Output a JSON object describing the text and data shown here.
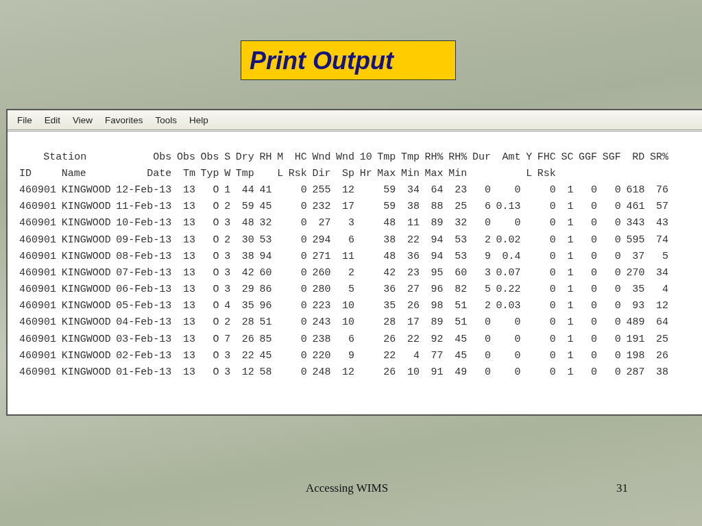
{
  "title": "Print Output",
  "window": {
    "menu": [
      "File",
      "Edit",
      "View",
      "Favorites",
      "Tools",
      "Help"
    ]
  },
  "table": {
    "columns": [
      {
        "group": "Station",
        "label": "ID",
        "kind": "text"
      },
      {
        "label": "Name",
        "kind": "text"
      },
      {
        "group": "Obs",
        "label": "Date",
        "kind": "number"
      },
      {
        "group": "Obs",
        "label": "Tm",
        "kind": "number"
      },
      {
        "group": "Obs",
        "label": "Typ",
        "kind": "number"
      },
      {
        "group": "S",
        "label": "W",
        "kind": "number"
      },
      {
        "group": "Dry",
        "label": "Tmp",
        "kind": "number"
      },
      {
        "group": "RH",
        "kind": "number"
      },
      {
        "group": "M",
        "label": "L",
        "kind": "number"
      },
      {
        "group": "HC",
        "label": "Rsk",
        "kind": "number"
      },
      {
        "group": "Wnd",
        "label": "Dir",
        "kind": "number"
      },
      {
        "group": "Wnd",
        "label": "Sp",
        "kind": "number"
      },
      {
        "group": "10",
        "label": "Hr",
        "kind": "number"
      },
      {
        "group": "Tmp",
        "label": "Max",
        "kind": "number"
      },
      {
        "group": "Tmp",
        "label": "Min",
        "kind": "number"
      },
      {
        "group": "RH%",
        "label": "Max",
        "kind": "number"
      },
      {
        "group": "RH%",
        "label": "Min",
        "kind": "number"
      },
      {
        "group": "Dur",
        "kind": "number"
      },
      {
        "group": "Amt",
        "kind": "number"
      },
      {
        "group": "Y",
        "label": "L",
        "kind": "number"
      },
      {
        "group": "FHC",
        "label": "Rsk",
        "kind": "number"
      },
      {
        "group": "SC",
        "kind": "number"
      },
      {
        "group": "GGF",
        "kind": "number"
      },
      {
        "group": "SGF",
        "kind": "number"
      },
      {
        "group": "RD",
        "kind": "number"
      },
      {
        "group": "SR%",
        "kind": "number"
      }
    ],
    "rows": [
      [
        "460901",
        "KINGWOOD",
        "12-Feb-13",
        "13",
        "O",
        "1",
        "44",
        "41",
        null,
        "0",
        "255",
        "12",
        null,
        "59",
        "34",
        "64",
        "23",
        "0",
        "0",
        null,
        "0",
        "1",
        "0",
        "0",
        "618",
        "76"
      ],
      [
        "460901",
        "KINGWOOD",
        "11-Feb-13",
        "13",
        "O",
        "2",
        "59",
        "45",
        null,
        "0",
        "232",
        "17",
        null,
        "59",
        "38",
        "88",
        "25",
        "6",
        "0.13",
        null,
        "0",
        "1",
        "0",
        "0",
        "461",
        "57"
      ],
      [
        "460901",
        "KINGWOOD",
        "10-Feb-13",
        "13",
        "O",
        "3",
        "48",
        "32",
        null,
        "0",
        "27",
        "3",
        null,
        "48",
        "11",
        "89",
        "32",
        "0",
        "0",
        null,
        "0",
        "1",
        "0",
        "0",
        "343",
        "43"
      ],
      [
        "460901",
        "KINGWOOD",
        "09-Feb-13",
        "13",
        "O",
        "2",
        "30",
        "53",
        null,
        "0",
        "294",
        "6",
        null,
        "38",
        "22",
        "94",
        "53",
        "2",
        "0.02",
        null,
        "0",
        "1",
        "0",
        "0",
        "595",
        "74"
      ],
      [
        "460901",
        "KINGWOOD",
        "08-Feb-13",
        "13",
        "O",
        "3",
        "38",
        "94",
        null,
        "0",
        "271",
        "11",
        null,
        "48",
        "36",
        "94",
        "53",
        "9",
        "0.4",
        null,
        "0",
        "1",
        "0",
        "0",
        "37",
        "5"
      ],
      [
        "460901",
        "KINGWOOD",
        "07-Feb-13",
        "13",
        "O",
        "3",
        "42",
        "60",
        null,
        "0",
        "260",
        "2",
        null,
        "42",
        "23",
        "95",
        "60",
        "3",
        "0.07",
        null,
        "0",
        "1",
        "0",
        "0",
        "270",
        "34"
      ],
      [
        "460901",
        "KINGWOOD",
        "06-Feb-13",
        "13",
        "O",
        "3",
        "29",
        "86",
        null,
        "0",
        "280",
        "5",
        null,
        "36",
        "27",
        "96",
        "82",
        "5",
        "0.22",
        null,
        "0",
        "1",
        "0",
        "0",
        "35",
        "4"
      ],
      [
        "460901",
        "KINGWOOD",
        "05-Feb-13",
        "13",
        "O",
        "4",
        "35",
        "96",
        null,
        "0",
        "223",
        "10",
        null,
        "35",
        "26",
        "98",
        "51",
        "2",
        "0.03",
        null,
        "0",
        "1",
        "0",
        "0",
        "93",
        "12"
      ],
      [
        "460901",
        "KINGWOOD",
        "04-Feb-13",
        "13",
        "O",
        "2",
        "28",
        "51",
        null,
        "0",
        "243",
        "10",
        null,
        "28",
        "17",
        "89",
        "51",
        "0",
        "0",
        null,
        "0",
        "1",
        "0",
        "0",
        "489",
        "64"
      ],
      [
        "460901",
        "KINGWOOD",
        "03-Feb-13",
        "13",
        "O",
        "7",
        "26",
        "85",
        null,
        "0",
        "238",
        "6",
        null,
        "26",
        "22",
        "92",
        "45",
        "0",
        "0",
        null,
        "0",
        "1",
        "0",
        "0",
        "191",
        "25"
      ],
      [
        "460901",
        "KINGWOOD",
        "02-Feb-13",
        "13",
        "O",
        "3",
        "22",
        "45",
        null,
        "0",
        "220",
        "9",
        null,
        "22",
        "4",
        "77",
        "45",
        "0",
        "0",
        null,
        "0",
        "1",
        "0",
        "0",
        "198",
        "26"
      ],
      [
        "460901",
        "KINGWOOD",
        "01-Feb-13",
        "13",
        "O",
        "3",
        "12",
        "58",
        null,
        "0",
        "248",
        "12",
        null,
        "26",
        "10",
        "91",
        "49",
        "0",
        "0",
        null,
        "0",
        "1",
        "0",
        "0",
        "287",
        "38"
      ]
    ]
  },
  "footer": {
    "text": "Accessing WIMS",
    "page_number": "31"
  }
}
